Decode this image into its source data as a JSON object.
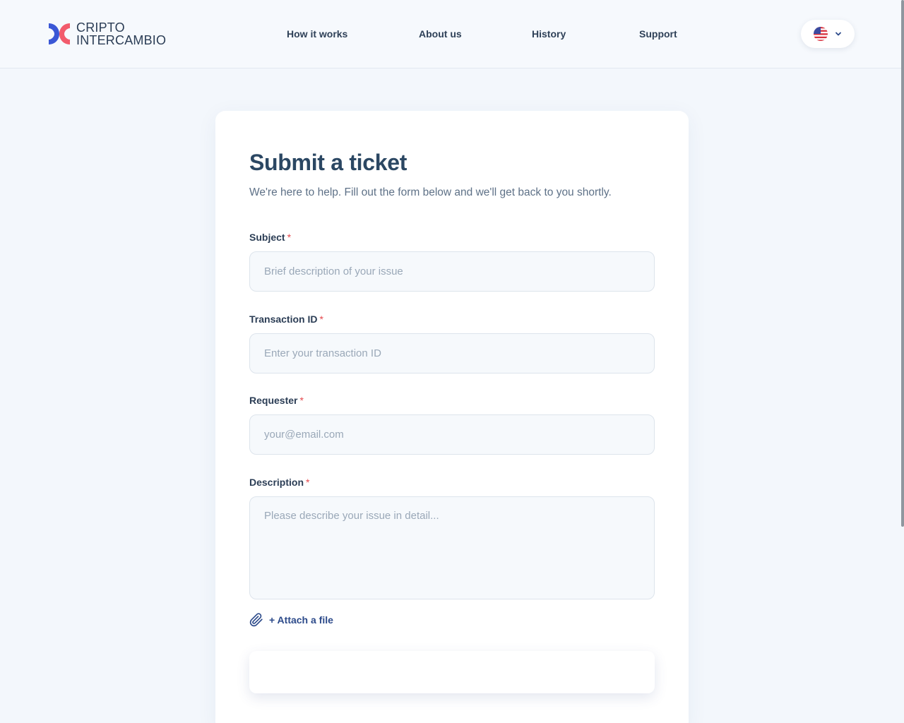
{
  "brand": {
    "line1": "CRIPTO",
    "line2": "INTERCAMBIO",
    "colors": {
      "blue": "#3a57d6",
      "coral": "#f25b6c"
    }
  },
  "nav": {
    "items": [
      {
        "label": "How it works"
      },
      {
        "label": "About us"
      },
      {
        "label": "History"
      },
      {
        "label": "Support"
      }
    ]
  },
  "language": {
    "icon": "us-flag-icon",
    "chevron": "chevron-down-icon"
  },
  "form": {
    "title": "Submit a ticket",
    "subtitle": "We're here to help. Fill out the form below and we'll get back to you shortly.",
    "required_marker": "*",
    "subject": {
      "label": "Subject",
      "placeholder": "Brief description of your issue",
      "value": ""
    },
    "transaction": {
      "label": "Transaction ID",
      "placeholder": "Enter your transaction ID",
      "value": ""
    },
    "requester": {
      "label": "Requester",
      "placeholder": "your@email.com",
      "value": ""
    },
    "description": {
      "label": "Description",
      "placeholder": "Please describe your issue in detail...",
      "value": ""
    },
    "attach_label": "+ Attach a file",
    "submit_label": ""
  }
}
